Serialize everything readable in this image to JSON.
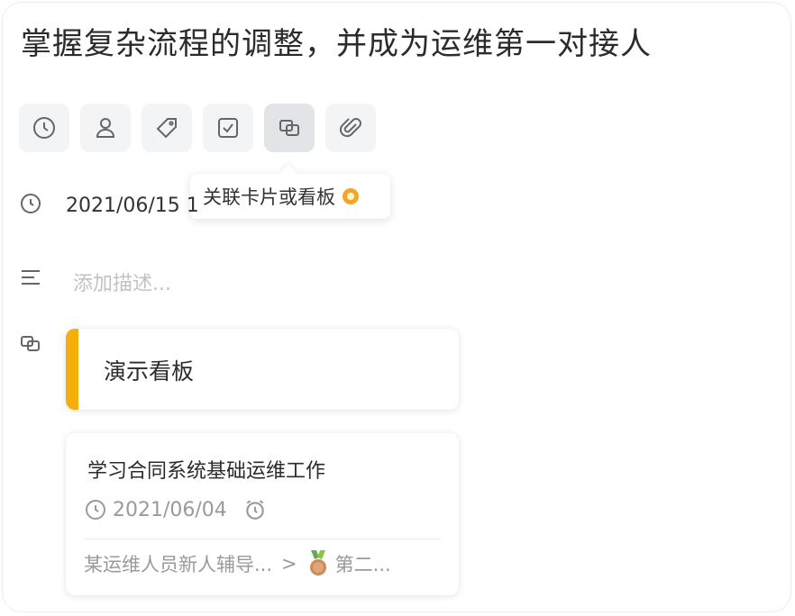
{
  "title": "掌握复杂流程的调整，并成为运维第一对接人",
  "toolbar": {
    "buttons": [
      {
        "icon": "clock-icon"
      },
      {
        "icon": "user-icon"
      },
      {
        "icon": "tag-icon"
      },
      {
        "icon": "checkbox-icon"
      },
      {
        "icon": "link-cards-icon",
        "active": true
      },
      {
        "icon": "paperclip-icon"
      }
    ]
  },
  "tooltip": {
    "text": "关联卡片或看板"
  },
  "date_row": {
    "value": "2021/06/15 1"
  },
  "description": {
    "placeholder": "添加描述..."
  },
  "linked": {
    "board": {
      "name": "演示看板",
      "accent": "#f5ae0a"
    },
    "card": {
      "title": "学习合同系统基础运维工作",
      "due_date": "2021/06/04",
      "path_parent": "某运维人员新人辅导...",
      "path_sep": ">",
      "path_child": "第二..."
    }
  }
}
